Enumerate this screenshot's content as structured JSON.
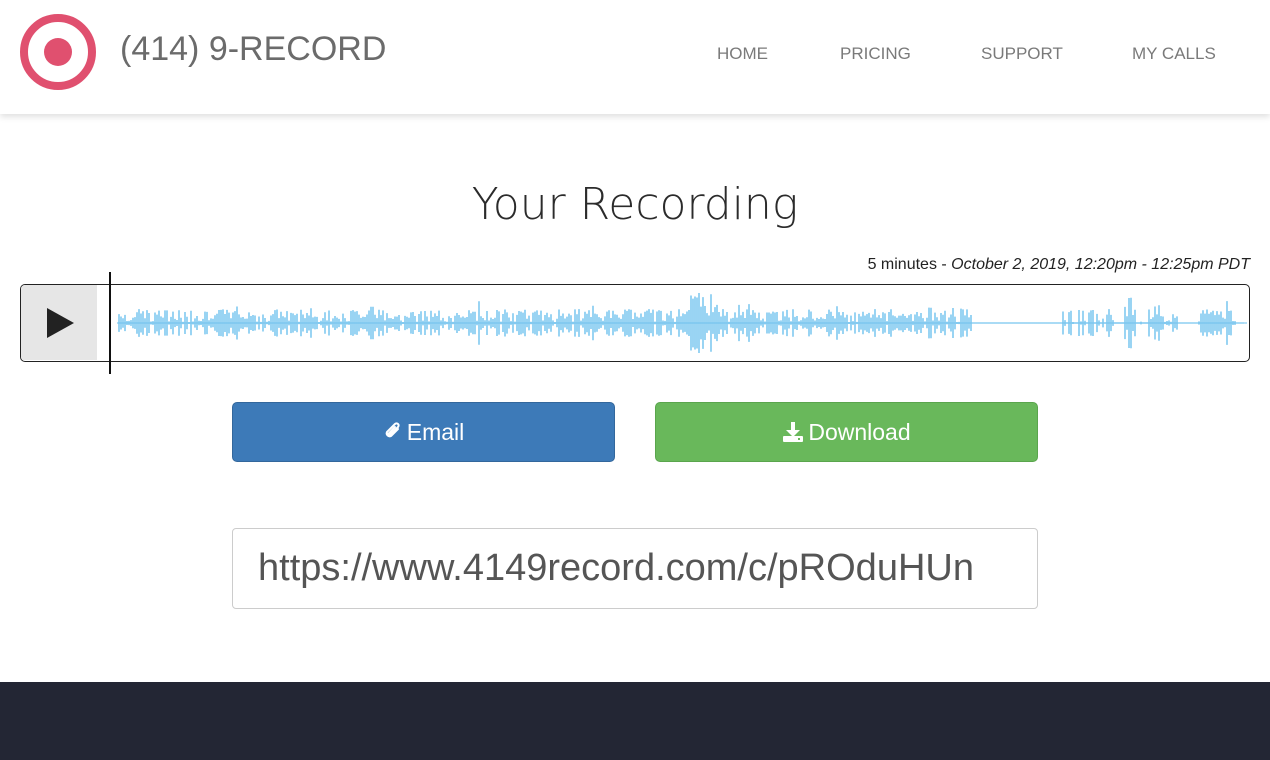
{
  "brand": {
    "name": "(414) 9-RECORD",
    "logo_icon": "record-icon",
    "accent": "#e0506f"
  },
  "nav": {
    "items": [
      {
        "label": "HOME"
      },
      {
        "label": "PRICING"
      },
      {
        "label": "SUPPORT"
      },
      {
        "label": "MY CALLS"
      }
    ]
  },
  "recording": {
    "title": "Your Recording",
    "duration": "5 minutes",
    "separator": " - ",
    "date_range": "October 2, 2019, 12:20pm - 12:25pm PDT",
    "play_icon": "play-icon",
    "progress": 0,
    "waveform_color": "#6ec1ee"
  },
  "actions": {
    "email_label": "Email",
    "email_icon": "paperclip-icon",
    "email_color": "#3d7ab8",
    "download_label": "Download",
    "download_icon": "download-icon",
    "download_color": "#69b85b"
  },
  "share": {
    "url": "https://www.4149record.com/c/pROduHUn"
  },
  "footer": {
    "color": "#232634"
  }
}
